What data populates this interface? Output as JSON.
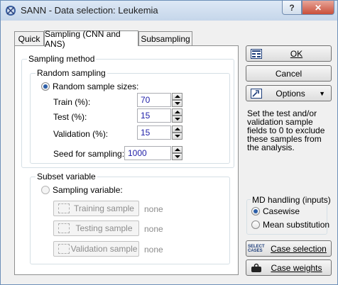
{
  "window": {
    "title": "SANN - Data selection: Leukemia"
  },
  "titlebar": {
    "help": "?",
    "close": "✕"
  },
  "tabs": [
    {
      "label": "Quick"
    },
    {
      "label": "Sampling (CNN and ANS)"
    },
    {
      "label": "Subsampling"
    }
  ],
  "sampling_method": {
    "label": "Sampling method",
    "random_sampling": {
      "label": "Random sampling",
      "option_label": "Random sample sizes:",
      "fields": [
        {
          "label": "Train (%):",
          "value": "70"
        },
        {
          "label": "Test (%):",
          "value": "15"
        },
        {
          "label": "Validation (%):",
          "value": "15"
        }
      ],
      "seed": {
        "label": "Seed for sampling:",
        "value": "1000"
      }
    }
  },
  "subset_variable": {
    "label": "Subset variable",
    "option_label": "Sampling variable:",
    "buttons": [
      {
        "label": "Training sample",
        "status": "none"
      },
      {
        "label": "Testing sample",
        "status": "none"
      },
      {
        "label": "Validation sample",
        "status": "none"
      }
    ]
  },
  "side": {
    "ok": "OK",
    "cancel": "Cancel",
    "options": "Options",
    "note": "Set the test and/or validation sample fields to 0 to exclude these samples from the analysis.",
    "md_handling": {
      "label": "MD handling (inputs)",
      "options": [
        "Casewise",
        "Mean substitution"
      ],
      "selected": "Casewise"
    },
    "case_selection": "Case selection",
    "case_selection_icon_text": "SELECT CASES",
    "case_weights": "Case weights"
  },
  "colors": {
    "value_text": "#1f1fa8",
    "titlebar": "#c5d6ea",
    "close": "#c94f3a"
  }
}
